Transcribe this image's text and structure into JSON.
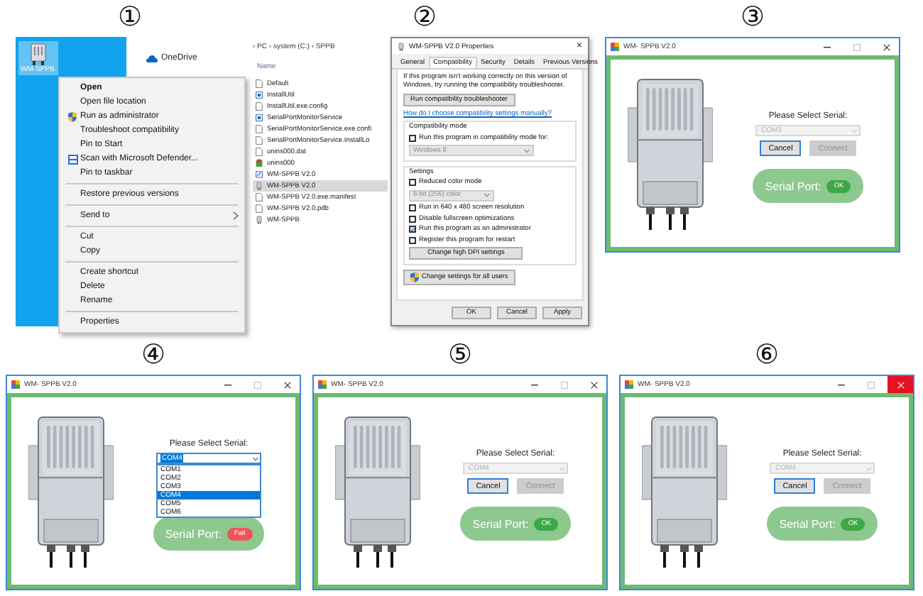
{
  "steps": [
    {
      "kind": "context_menu",
      "number": "①",
      "desktop_icon": {
        "label": "WM-SPPB",
        "selected": true
      },
      "onedrive": "OneDrive",
      "menu_sections": [
        [
          {
            "label": "Open",
            "bold": true,
            "submenu": false
          },
          {
            "label": "Open file location",
            "bold": false,
            "submenu": false
          },
          {
            "label": "Run as administrator",
            "bold": false,
            "submenu": false,
            "kind": "shield"
          },
          {
            "label": "Troubleshoot compatibility",
            "bold": false,
            "submenu": false
          },
          {
            "label": "Pin to Start",
            "bold": false,
            "submenu": false
          },
          {
            "label": "Scan with Microsoft Defender...",
            "bold": false,
            "submenu": false,
            "kind": "scan"
          },
          {
            "label": "Pin to taskbar",
            "bold": false,
            "submenu": false
          }
        ],
        [
          {
            "label": "Restore previous versions",
            "bold": false,
            "submenu": false
          }
        ],
        [
          {
            "label": "Send to",
            "bold": false,
            "submenu": true
          }
        ],
        [
          {
            "label": "Cut",
            "bold": false,
            "submenu": false
          },
          {
            "label": "Copy",
            "bold": false,
            "submenu": false
          }
        ],
        [
          {
            "label": "Create shortcut",
            "bold": false,
            "submenu": false
          },
          {
            "label": "Delete",
            "bold": false,
            "submenu": false
          },
          {
            "label": "Rename",
            "bold": false,
            "submenu": false
          }
        ],
        [
          {
            "label": "Properties",
            "bold": false,
            "submenu": false
          }
        ]
      ]
    },
    {
      "kind": "properties",
      "number": "②",
      "explorer": {
        "breadcrumb": "› PC › system (C:) › SPPB",
        "column": "Name",
        "files": [
          {
            "name": "Default",
            "kind": "doc",
            "selected": false
          },
          {
            "name": "InstallUtil",
            "kind": "app",
            "selected": false
          },
          {
            "name": "InstallUtil.exe.config",
            "kind": "doc",
            "selected": false
          },
          {
            "name": "SerialPortMonitorService",
            "kind": "app",
            "selected": false
          },
          {
            "name": "SerialPortMonitorService.exe.confi",
            "kind": "doc",
            "selected": false
          },
          {
            "name": "SerialPortMonitorService.InstallLo",
            "kind": "doc",
            "selected": false
          },
          {
            "name": "unins000.dat",
            "kind": "doc",
            "selected": false
          },
          {
            "name": "unins000",
            "kind": "setup",
            "selected": false
          },
          {
            "name": "WM-SPPB V2.0",
            "kind": "shortcut",
            "selected": false
          },
          {
            "name": "WM-SPPB V2.0",
            "kind": "program",
            "selected": true
          },
          {
            "name": "WM-SPPB V2.0.exe.manifest",
            "kind": "doc",
            "selected": false
          },
          {
            "name": "WM-SPPB V2.0.pdb",
            "kind": "doc",
            "selected": false
          },
          {
            "name": "WM-SPPB",
            "kind": "program",
            "selected": false
          }
        ]
      },
      "dialog": {
        "title": "WM-SPPB V2.0 Properties",
        "close": "×",
        "tabs": [
          {
            "label": "General",
            "selected": false
          },
          {
            "label": "Compatibility",
            "selected": true
          },
          {
            "label": "Security",
            "selected": false
          },
          {
            "label": "Details",
            "selected": false
          },
          {
            "label": "Previous Versions",
            "selected": false
          }
        ],
        "intro": "If this program isn't working correctly on this version of Windows, try running the compatibility troubleshooter.",
        "troubleshoot_button": "Run compatibility troubleshooter",
        "help_link": "How do I choose compatibility settings manually?",
        "groups": [
          {
            "title": "Compatibility mode",
            "rows": [
              {
                "kind": "checkbox",
                "label": "Run this program in compatibility mode for:",
                "checked": false
              },
              {
                "kind": "select",
                "value": "Windows 8",
                "disabled": true
              }
            ]
          },
          {
            "title": "Settings",
            "rows": [
              {
                "kind": "checkbox",
                "label": "Reduced color mode",
                "checked": false
              },
              {
                "kind": "select",
                "value": "8-bit (256) color",
                "disabled": true
              },
              {
                "kind": "checkbox",
                "label": "Run in 640 x 480 screen resolution",
                "checked": false
              },
              {
                "kind": "checkbox",
                "label": "Disable fullscreen optimizations",
                "checked": false
              },
              {
                "kind": "checkbox",
                "label": "Run this program as an administrator",
                "checked": true
              },
              {
                "kind": "checkbox",
                "label": "Register this program for restart",
                "checked": false
              },
              {
                "kind": "button",
                "label": "Change high DPI settings"
              }
            ]
          }
        ],
        "all_users_button": "Change settings for all users",
        "footer_buttons": [
          "OK",
          "Cancel",
          "Apply"
        ]
      }
    },
    {
      "kind": "app",
      "number": "③",
      "window": {
        "title": "WM- SPPB V2.0",
        "close_hovered": false,
        "prompt": "Please Select Serial:",
        "combo": {
          "value": "COM3",
          "disabled": true,
          "open": false
        },
        "buttons": [
          {
            "label": "Cancel",
            "focused": true,
            "disabled": false
          },
          {
            "label": "Connect",
            "focused": false,
            "disabled": true
          }
        ],
        "status": {
          "label": "Serial Port:",
          "value": "OK",
          "kind": "ok"
        }
      }
    },
    {
      "kind": "app",
      "number": "④",
      "window": {
        "title": "WM- SPPB V2.0",
        "close_hovered": false,
        "prompt": "Please Select Serial:",
        "combo": {
          "value": "COM4",
          "disabled": false,
          "open": true,
          "options": [
            {
              "label": "COM1",
              "selected": false
            },
            {
              "label": "COM2",
              "selected": false
            },
            {
              "label": "COM3",
              "selected": false
            },
            {
              "label": "COM4",
              "selected": true
            },
            {
              "label": "COM5",
              "selected": false
            },
            {
              "label": "COM6",
              "selected": false
            }
          ]
        },
        "status": {
          "label": "Serial Port:",
          "value": "Fail",
          "kind": "fail"
        }
      }
    },
    {
      "kind": "app",
      "number": "⑤",
      "window": {
        "title": "WM- SPPB V2.0",
        "close_hovered": false,
        "prompt": "Please Select Serial:",
        "combo": {
          "value": "COM4",
          "disabled": true,
          "open": false
        },
        "buttons": [
          {
            "label": "Cancel",
            "focused": true,
            "disabled": false
          },
          {
            "label": "Connect",
            "focused": false,
            "disabled": true
          }
        ],
        "status": {
          "label": "Serial Port:",
          "value": "OK",
          "kind": "ok"
        }
      }
    },
    {
      "kind": "app",
      "number": "⑥",
      "window": {
        "title": "WM- SPPB V2.0",
        "close_hovered": true,
        "prompt": "Please Select Serial:",
        "combo": {
          "value": "COM4",
          "disabled": true,
          "open": false
        },
        "buttons": [
          {
            "label": "Cancel",
            "focused": true,
            "disabled": false
          },
          {
            "label": "Connect",
            "focused": false,
            "disabled": true
          }
        ],
        "status": {
          "label": "Serial Port:",
          "value": "OK",
          "kind": "ok"
        }
      }
    }
  ]
}
